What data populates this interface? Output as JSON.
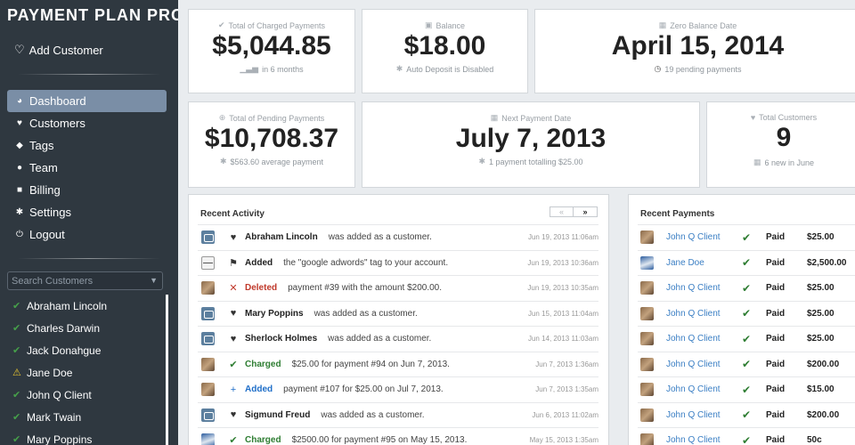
{
  "sidebar": {
    "brand": "PAYMENT PLAN PRO",
    "add_customer": "Add Customer",
    "nav": [
      {
        "label": "Dashboard",
        "icon": "dashboard-icon",
        "active": true
      },
      {
        "label": "Customers",
        "icon": "heart-icon"
      },
      {
        "label": "Tags",
        "icon": "tag-icon"
      },
      {
        "label": "Team",
        "icon": "user-icon"
      },
      {
        "label": "Billing",
        "icon": "lock-icon"
      },
      {
        "label": "Settings",
        "icon": "gear-icon"
      },
      {
        "label": "Logout",
        "icon": "power-icon"
      }
    ],
    "search_placeholder": "Search Customers",
    "customers": [
      {
        "name": "Abraham Lincoln",
        "status": "ok"
      },
      {
        "name": "Charles Darwin",
        "status": "ok"
      },
      {
        "name": "Jack Donahgue",
        "status": "ok"
      },
      {
        "name": "Jane Doe",
        "status": "warning"
      },
      {
        "name": "John Q Client",
        "status": "ok"
      },
      {
        "name": "Mark Twain",
        "status": "ok"
      },
      {
        "name": "Mary Poppins",
        "status": "ok"
      }
    ]
  },
  "stats": {
    "charged": {
      "label": "Total of Charged Payments",
      "value": "$5,044.85",
      "sub": "in 6 months"
    },
    "balance": {
      "label": "Balance",
      "value": "$18.00",
      "sub": "Auto Deposit is Disabled"
    },
    "zero_balance": {
      "label": "Zero Balance Date",
      "value": "April 15, 2014",
      "sub": "19 pending payments"
    },
    "pending": {
      "label": "Total of Pending Payments",
      "value": "$10,708.37",
      "sub": "$563.60 average payment"
    },
    "next_payment": {
      "label": "Next Payment Date",
      "value": "July 7, 2013",
      "sub": "1 payment totalling $25.00"
    },
    "customers": {
      "label": "Total Customers",
      "value": "9",
      "sub": "6 new in June"
    }
  },
  "activity": {
    "title": "Recent Activity",
    "pager_prev": "«",
    "pager_next": "»",
    "rows": [
      {
        "avatar": "cam",
        "tick": "♥",
        "tick_class": "",
        "name": "Abraham Lincoln",
        "name_class": "",
        "desc": "was added as a customer.",
        "time": "Jun 19, 2013 11:06am"
      },
      {
        "avatar": "line",
        "tick": "⚑",
        "tick_class": "",
        "name": "Added",
        "name_class": "",
        "desc": "the \"google adwords\" tag to your account.",
        "time": "Jun 19, 2013 10:36am"
      },
      {
        "avatar": "photo",
        "tick": "✕",
        "tick_class": "kw-deleted",
        "name": "Deleted",
        "name_class": "kw-deleted",
        "desc": "payment #39 with the amount $200.00.",
        "time": "Jun 19, 2013 10:35am"
      },
      {
        "avatar": "cam",
        "tick": "♥",
        "tick_class": "",
        "name": "Mary Poppins",
        "name_class": "",
        "desc": "was added as a customer.",
        "time": "Jun 15, 2013 11:04am"
      },
      {
        "avatar": "cam",
        "tick": "♥",
        "tick_class": "",
        "name": "Sherlock Holmes",
        "name_class": "",
        "desc": "was added as a customer.",
        "time": "Jun 14, 2013 11:03am"
      },
      {
        "avatar": "photo",
        "tick": "✔",
        "tick_class": "kw-charged",
        "name": "Charged",
        "name_class": "kw-charged",
        "desc": "$25.00 for payment #94 on Jun 7, 2013.",
        "time": "Jun 7, 2013 1:36am"
      },
      {
        "avatar": "photo",
        "tick": "+",
        "tick_class": "kw-added-blue",
        "name": "Added",
        "name_class": "kw-added-blue",
        "desc": "payment #107 for $25.00 on Jul 7, 2013.",
        "time": "Jun 7, 2013 1:35am"
      },
      {
        "avatar": "cam",
        "tick": "♥",
        "tick_class": "",
        "name": "Sigmund Freud",
        "name_class": "",
        "desc": "was added as a customer.",
        "time": "Jun 6, 2013 11:02am"
      },
      {
        "avatar": "jane",
        "tick": "✔",
        "tick_class": "kw-charged",
        "name": "Charged",
        "name_class": "kw-charged",
        "desc": "$2500.00 for payment #95 on May 15, 2013.",
        "time": "May 15, 2013 1:35am"
      }
    ]
  },
  "payments": {
    "title": "Recent Payments",
    "rows": [
      {
        "avatar": "photo",
        "client": "John Q Client",
        "status": "Paid",
        "amount": "$25.00"
      },
      {
        "avatar": "jane",
        "client": "Jane Doe",
        "status": "Paid",
        "amount": "$2,500.00"
      },
      {
        "avatar": "photo",
        "client": "John Q Client",
        "status": "Paid",
        "amount": "$25.00"
      },
      {
        "avatar": "photo",
        "client": "John Q Client",
        "status": "Paid",
        "amount": "$25.00"
      },
      {
        "avatar": "photo",
        "client": "John Q Client",
        "status": "Paid",
        "amount": "$25.00"
      },
      {
        "avatar": "photo",
        "client": "John Q Client",
        "status": "Paid",
        "amount": "$200.00"
      },
      {
        "avatar": "photo",
        "client": "John Q Client",
        "status": "Paid",
        "amount": "$15.00"
      },
      {
        "avatar": "photo",
        "client": "John Q Client",
        "status": "Paid",
        "amount": "$200.00"
      },
      {
        "avatar": "photo",
        "client": "John Q Client",
        "status": "Paid",
        "amount": "50c"
      }
    ]
  },
  "colors": {
    "sidebar_bg": "#2f3840",
    "active_nav": "#7a8ea6",
    "charged_green": "#2e7d32",
    "deleted_red": "#c0392b",
    "link_blue": "#3b7fc4"
  }
}
